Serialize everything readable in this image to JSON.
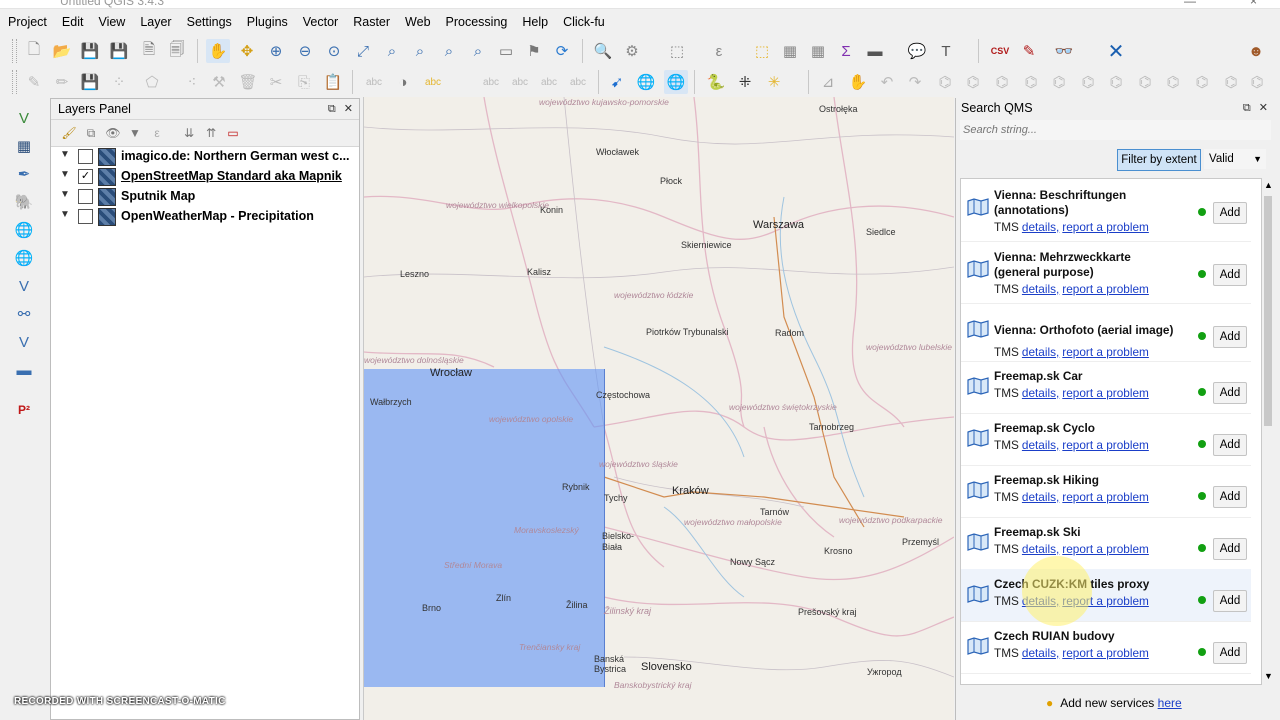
{
  "window": {
    "title": "Untitled QGIS 3.4.3",
    "close_glyph": "×",
    "minimize_glyph": "—"
  },
  "menu": [
    "Project",
    "Edit",
    "View",
    "Layer",
    "Settings",
    "Plugins",
    "Vector",
    "Raster",
    "Web",
    "Processing",
    "Help",
    "Click-fu"
  ],
  "layers_panel": {
    "title": "Layers Panel",
    "layers": [
      {
        "name": "imagico.de: Northern German west c...",
        "checked": false,
        "selected": false
      },
      {
        "name": "OpenStreetMap Standard aka Mapnik",
        "checked": true,
        "selected": true
      },
      {
        "name": "Sputnik Map",
        "checked": false,
        "selected": false
      },
      {
        "name": "OpenWeatherMap - Precipitation",
        "checked": false,
        "selected": false
      }
    ]
  },
  "map": {
    "cities": [
      "Włocławek",
      "Płock",
      "Konin",
      "Warszawa",
      "Siedlce",
      "Skierniewice",
      "Leszno",
      "Kalisz",
      "Piotrków Trybunalski",
      "Radom",
      "Wrocław",
      "Wałbrzych",
      "Częstochowa",
      "Tarnobrzeg",
      "Rybnik",
      "Tychy",
      "Kraków",
      "Tarnów",
      "Przemyśl",
      "Bielsko-Biała",
      "Nowy Sącz",
      "Krosno",
      "Zlín",
      "Brno",
      "Žilina",
      "Slovensko",
      "Prešovský kraj",
      "Ужгород",
      "Banská Bystrica",
      "Žilinský kraj",
      "Ostrołęka"
    ],
    "regions": [
      "województwo kujawsko-pomorskie",
      "województwo wielkopolskie",
      "województwo łódzkie",
      "województwo lubelskie",
      "województwo świętokrzyskie",
      "województwo opolskie",
      "województwo śląskie",
      "województwo małopolskie",
      "województwo podkarpackie",
      "Moravskoslezský",
      "Střední Morava",
      "Trenčiansky kraj",
      "Banskobystrický kraj",
      "województwo dolnośląskie"
    ]
  },
  "qms": {
    "title": "Search QMS",
    "search_placeholder": "Search string...",
    "filter_label": "Filter by extent",
    "status_select": "Valid",
    "details_label": "details,",
    "report_label": "report a problem",
    "add_label": "Add",
    "services": [
      {
        "name": "Vienna: Beschriftungen (annotations)",
        "type": "TMS"
      },
      {
        "name": "Vienna: Mehrzweckkarte (general purpose)",
        "type": "TMS"
      },
      {
        "name": "Vienna: Orthofoto (aerial image)",
        "type": "TMS"
      },
      {
        "name": "Freemap.sk Car",
        "type": "TMS"
      },
      {
        "name": "Freemap.sk Cyclo",
        "type": "TMS"
      },
      {
        "name": "Freemap.sk Hiking",
        "type": "TMS"
      },
      {
        "name": "Freemap.sk Ski",
        "type": "TMS"
      },
      {
        "name": "Czech CUZK:KM tiles proxy",
        "type": "TMS"
      },
      {
        "name": "Czech RUIAN budovy",
        "type": "TMS"
      }
    ],
    "footer_text": "Add new services",
    "footer_link": "here",
    "status_color": "#12a012"
  },
  "watermark": "RECORDED WITH SCREENCAST-O-MATIC"
}
